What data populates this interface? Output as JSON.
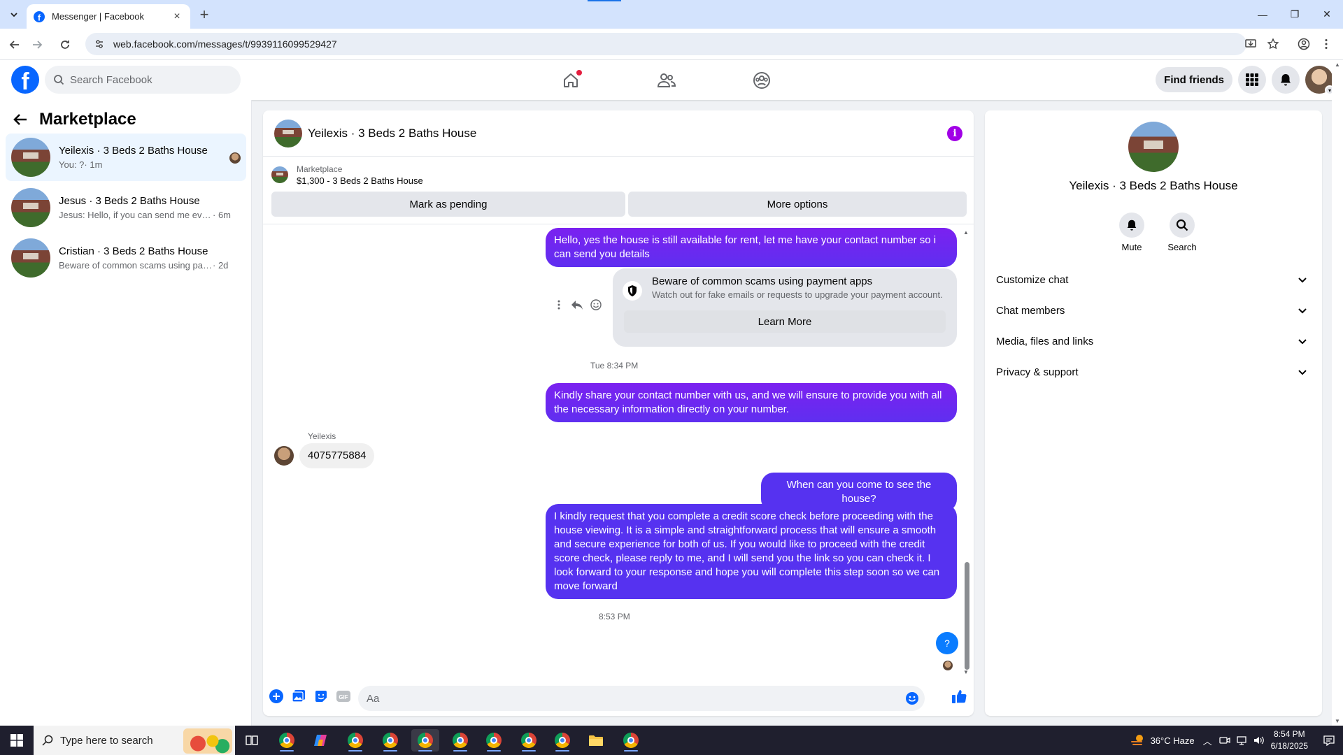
{
  "browser": {
    "tab_title": "Messenger | Facebook",
    "url": "web.facebook.com/messages/t/9939116099529427"
  },
  "fb_header": {
    "search_placeholder": "Search Facebook",
    "find_friends": "Find friends"
  },
  "sidebar": {
    "title": "Marketplace",
    "conversations": [
      {
        "name": "Yeilexis · 3 Beds 2 Baths House",
        "preview": "You: ?",
        "time": " · 1m"
      },
      {
        "name": "Jesus · 3 Beds 2 Baths House",
        "preview": "Jesus: Hello, if you can send me every...",
        "time": " · 6m"
      },
      {
        "name": "Cristian · 3 Beds 2 Baths House",
        "preview": "Beware of common scams using pay...",
        "time": " · 2d"
      }
    ]
  },
  "chat": {
    "title": "Yeilexis · 3 Beds 2 Baths House",
    "listing_label": "Marketplace",
    "listing_price": "$1,300 - 3 Beds 2 Baths House",
    "mark_pending": "Mark as pending",
    "more_options": "More options",
    "messages": {
      "m1": "Hello, yes the house is still available for rent, let me have your contact number so i can send you  details",
      "scam_title": "Beware of common scams using payment apps",
      "scam_sub": "Watch out for fake emails or requests to upgrade your payment account.",
      "learn_more": "Learn More",
      "ts1": "Tue 8:34 PM",
      "m2": "Kindly share your contact number with us, and we will ensure to provide you with all the necessary information directly on your number.",
      "sender": "Yeilexis",
      "m3": "4075775884",
      "m4": "When can you come to see the house?",
      "m5": "I kindly request that you complete a credit score check before proceeding with the house  viewing. It is a simple and straightforward process that will ensure a smooth and secure experience for both of us. If you would like to proceed with the credit score check, please reply to me, and I will send you the link so you can check it. I look forward to your response and hope you will complete this step soon so we can move forward",
      "ts2": "8:53 PM",
      "m6": "?"
    },
    "composer_placeholder": "Aa"
  },
  "info_panel": {
    "name": "Yeilexis · 3 Beds 2 Baths House",
    "mute": "Mute",
    "search": "Search",
    "sections": [
      "Customize chat",
      "Chat members",
      "Media, files and links",
      "Privacy & support"
    ]
  },
  "taskbar": {
    "search_placeholder": "Type here to search",
    "weather": "36°C  Haze",
    "time": "8:54 PM",
    "date": "6/18/2025"
  },
  "colors": {
    "fb_blue": "#0866ff",
    "bubble_purple": "#8a1be8",
    "bubble_indigo": "#5632f0",
    "info_accent": "#a100e6"
  }
}
